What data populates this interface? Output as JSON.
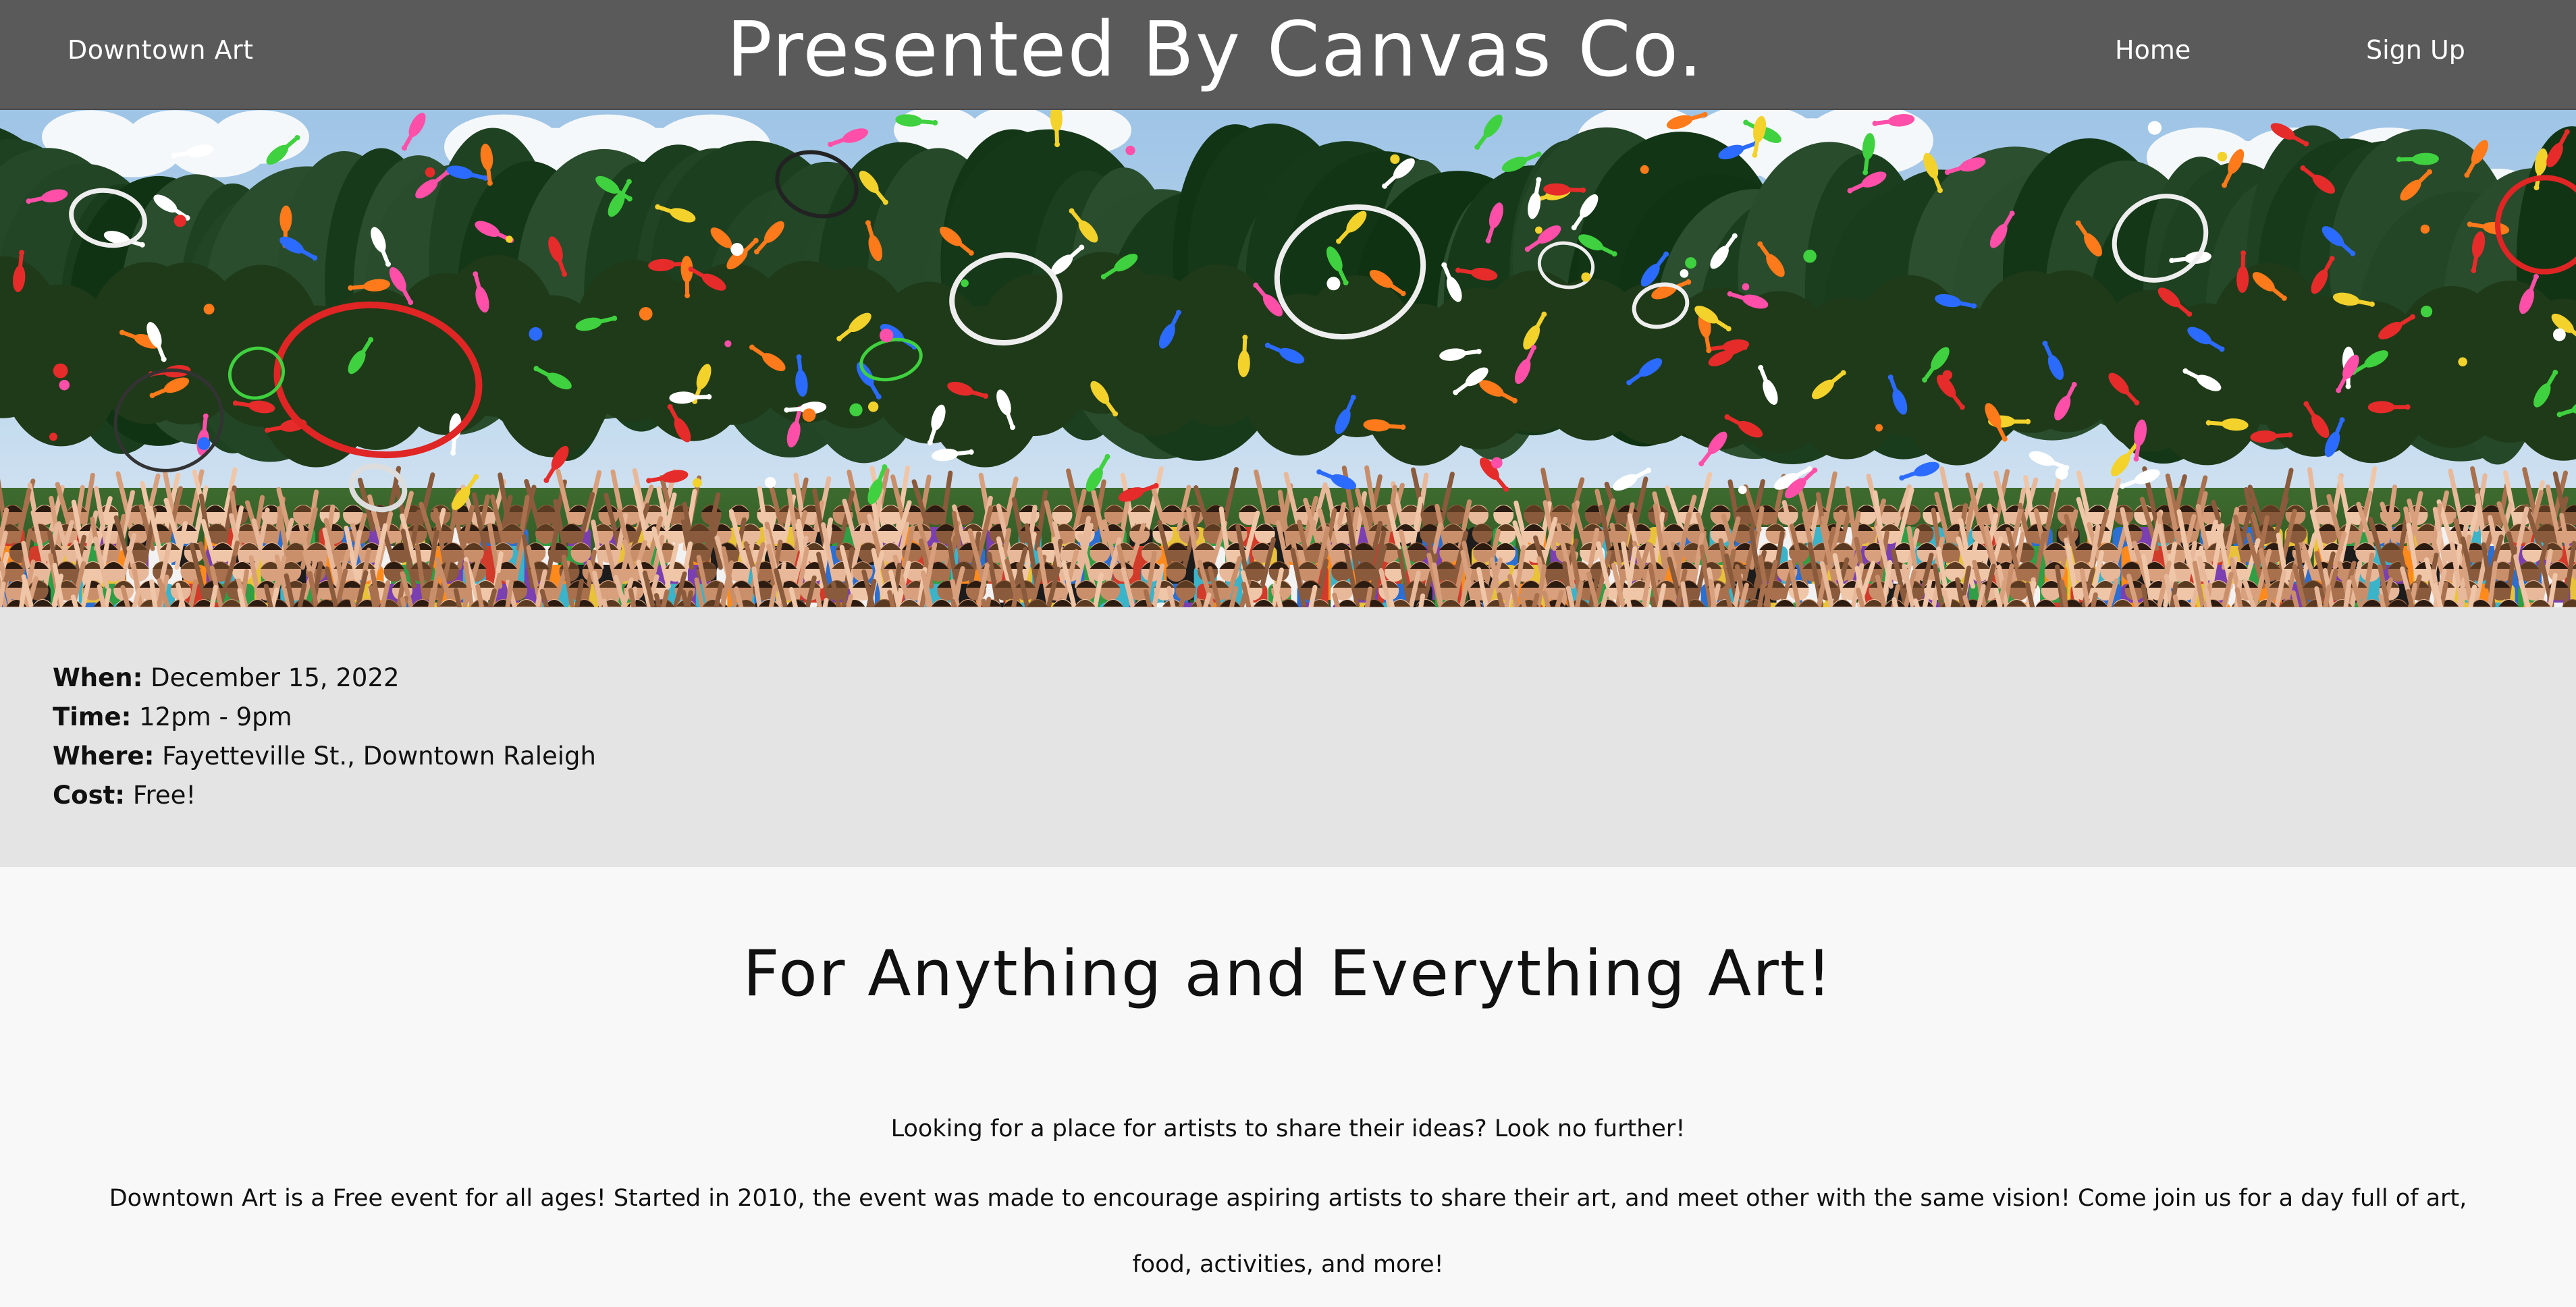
{
  "header": {
    "brand": "Downtown Art",
    "title": "Presented By Canvas Co.",
    "nav": {
      "home": "Home",
      "signup": "Sign Up"
    }
  },
  "hero": {
    "image": "juggling-crowd-photo"
  },
  "event": {
    "when_label": "When:",
    "when_value": "December 15, 2022",
    "time_label": "Time:",
    "time_value": "12pm - 9pm",
    "where_label": "Where:",
    "where_value": "Fayetteville St., Downtown Raleigh",
    "cost_label": "Cost:",
    "cost_value": "Free!"
  },
  "main": {
    "heading": "For Anything and Everything Art!",
    "intro": "Looking for a place for artists to share their ideas? Look no further!",
    "body": "Downtown Art is a Free event for all ages! Started in 2010, the event was made to encourage aspiring artists to share their art, and meet other with the same vision! Come join us for a day full of art, food, activities, and more!"
  },
  "colors": {
    "header_bg": "#5a5a5a",
    "info_bg": "#e4e4e4",
    "page_bg": "#f8f8f8"
  }
}
